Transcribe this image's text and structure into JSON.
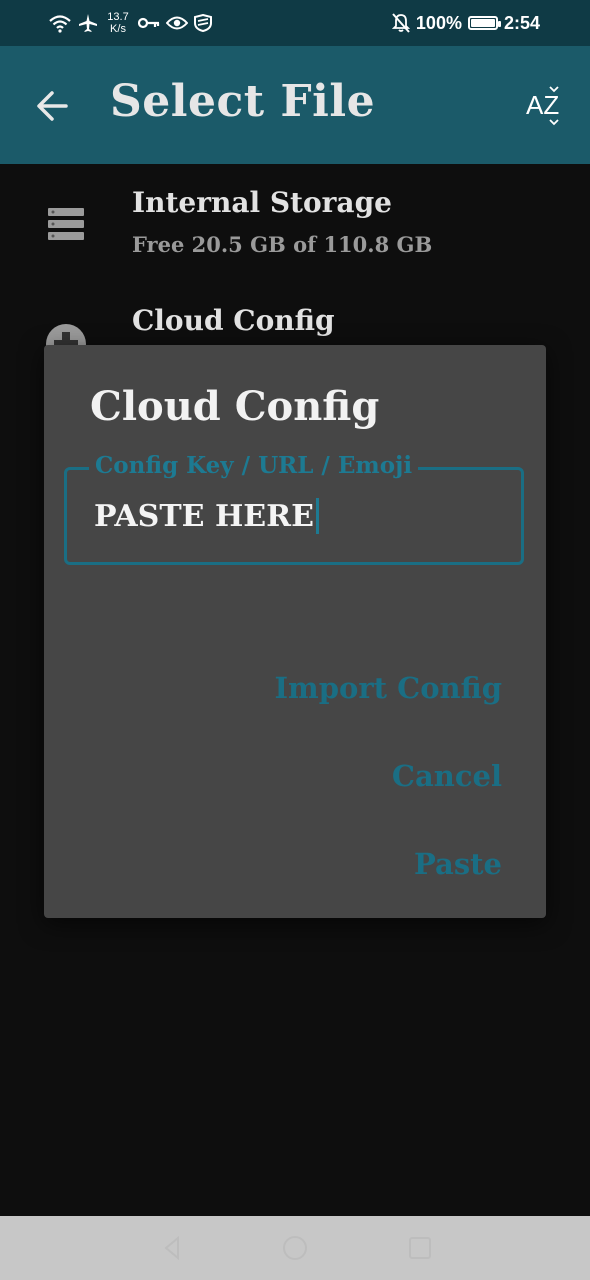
{
  "status_bar": {
    "speed_value": "13.7",
    "speed_unit": "K/s",
    "battery": "100%",
    "time": "2:54",
    "icons": [
      "wifi-icon",
      "airplane-icon",
      "key-icon",
      "eye-icon",
      "shield-icon",
      "mute-icon",
      "battery-icon"
    ]
  },
  "app_bar": {
    "title": "Select File",
    "sort_label": "AZ"
  },
  "list": {
    "items": [
      {
        "title": "Internal Storage",
        "subtitle": "Free 20.5 GB of 110.8 GB",
        "icon": "storage-icon"
      },
      {
        "title": "Cloud Config",
        "icon": "cloud-icon"
      }
    ]
  },
  "dialog": {
    "title": "Cloud Config",
    "field_label": "Config Key / URL / Emoji",
    "field_value": "PASTE HERE",
    "buttons": {
      "import": "Import Config",
      "cancel": "Cancel",
      "paste": "Paste"
    }
  },
  "colors": {
    "status_bar": "#0f3a45",
    "app_bar": "#1b5a69",
    "accent": "#1a6e84",
    "dialog_bg": "#464646",
    "background": "#0e0e0e"
  }
}
